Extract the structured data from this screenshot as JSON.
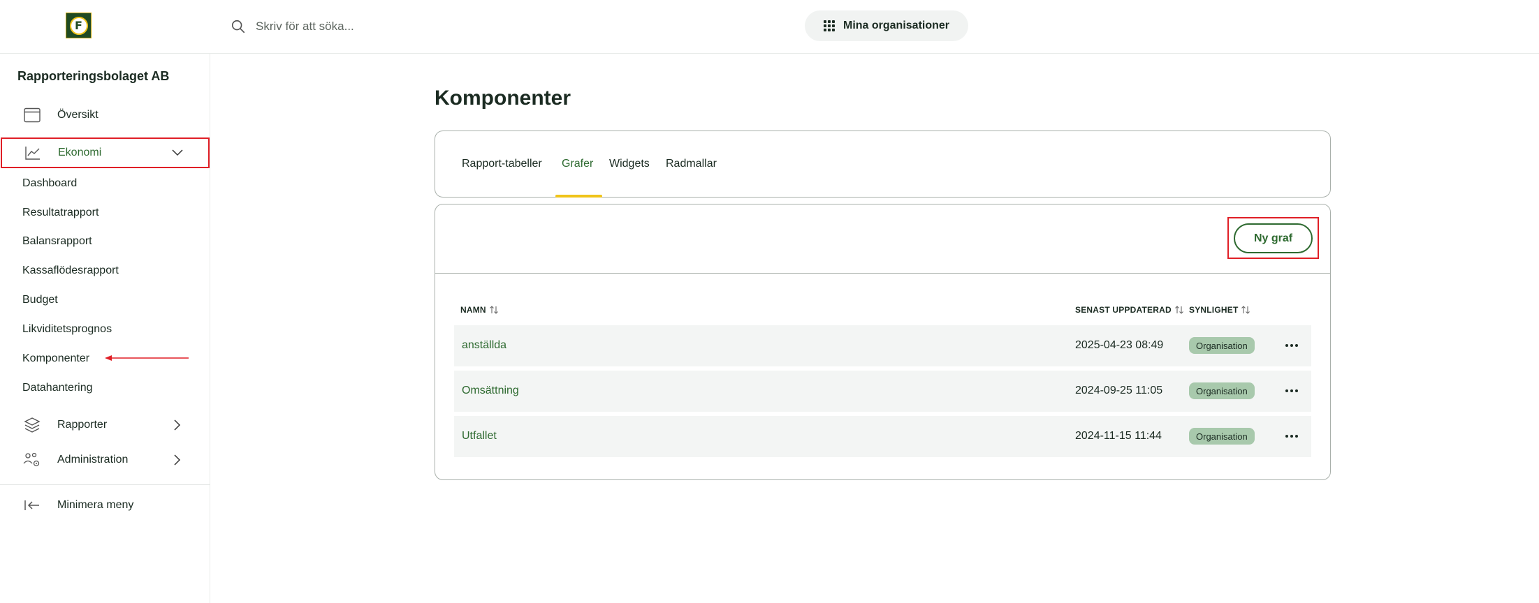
{
  "header": {
    "logo_letter": "F",
    "search_placeholder": "Skriv för att söka...",
    "orgs_label": "Mina organisationer"
  },
  "sidebar": {
    "company": "Rapporteringsbolaget AB",
    "items": [
      {
        "label": "Översikt",
        "icon": "calendar-icon"
      },
      {
        "label": "Ekonomi",
        "icon": "chart-line-icon",
        "expanded": true
      },
      {
        "label": "Rapporter",
        "icon": "layers-icon"
      },
      {
        "label": "Administration",
        "icon": "users-gear-icon"
      }
    ],
    "subitems": [
      "Dashboard",
      "Resultatrapport",
      "Balansrapport",
      "Kassaflödesrapport",
      "Budget",
      "Likviditetsprognos",
      "Komponenter",
      "Datahantering"
    ],
    "minimize_label": "Minimera meny"
  },
  "main": {
    "title": "Komponenter",
    "tabs": [
      {
        "label": "Rapport-tabeller"
      },
      {
        "label": "Grafer",
        "active": true
      },
      {
        "label": "Widgets"
      },
      {
        "label": "Radmallar"
      }
    ],
    "new_button": "Ny graf",
    "columns": {
      "name": "NAMN",
      "updated": "SENAST UPPDATERAD",
      "visibility": "SYNLIGHET"
    },
    "rows": [
      {
        "name": "anställda",
        "updated": "2025-04-23 08:49",
        "visibility": "Organisation"
      },
      {
        "name": "Omsättning",
        "updated": "2024-09-25 11:05",
        "visibility": "Organisation"
      },
      {
        "name": "Utfallet",
        "updated": "2024-11-15 11:44",
        "visibility": "Organisation"
      }
    ]
  },
  "colors": {
    "accent_green": "#2e6a30",
    "tab_underline": "#f0c419",
    "badge_bg": "#a8c9ac",
    "annotation_red": "#e01f26"
  }
}
